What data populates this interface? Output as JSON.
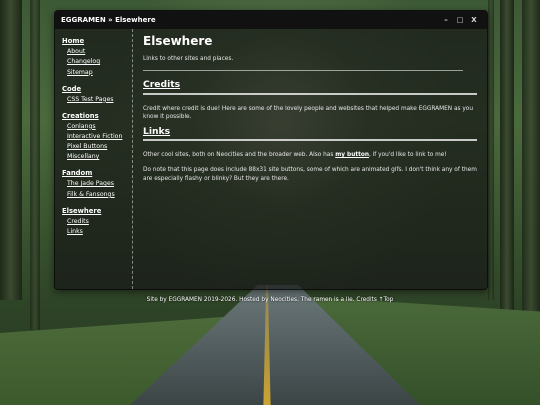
{
  "window": {
    "title": "EGGRAMEN » Elsewhere",
    "minimize": "–",
    "maximize": "□",
    "close": "X"
  },
  "sidebar": {
    "groups": [
      {
        "heading": "Home",
        "items": [
          "About",
          "Changelog",
          "Sitemap"
        ]
      },
      {
        "heading": "Code",
        "items": [
          "CSS Test Pages"
        ]
      },
      {
        "heading": "Creations",
        "items": [
          "Conlangs",
          "Interactive Fiction",
          "Pixel Buttons",
          "Miscellany"
        ]
      },
      {
        "heading": "Fandom",
        "items": [
          "The Jade Pages",
          "Filk & Fansongs"
        ]
      },
      {
        "heading": "Elsewhere",
        "items": [
          "Credits",
          "Links"
        ]
      }
    ]
  },
  "main": {
    "title": "Elsewhere",
    "intro": "Links to other sites and places.",
    "credits_heading": "Credits",
    "credits_text": "Credit where credit is due! Here are some of the lovely people and websites that helped make EGGRAMEN as you know it possible.",
    "links_heading": "Links",
    "links_text_before": "Other cool sites, both on Neocities and the broader web. Also has ",
    "links_button_link": "my button",
    "links_text_after": ", if you'd like to link to me!",
    "note": "Do note that this page does include 88x31 site buttons, some of which are animated gifs. I don't think any of them are especially flashy or blinky? But they are there."
  },
  "footer": {
    "text": "Site by EGGRAMEN 2019-2026. Hosted by Neocities. The ramen is a lie.",
    "credits_link": "Credits",
    "top_link": "↑Top"
  }
}
